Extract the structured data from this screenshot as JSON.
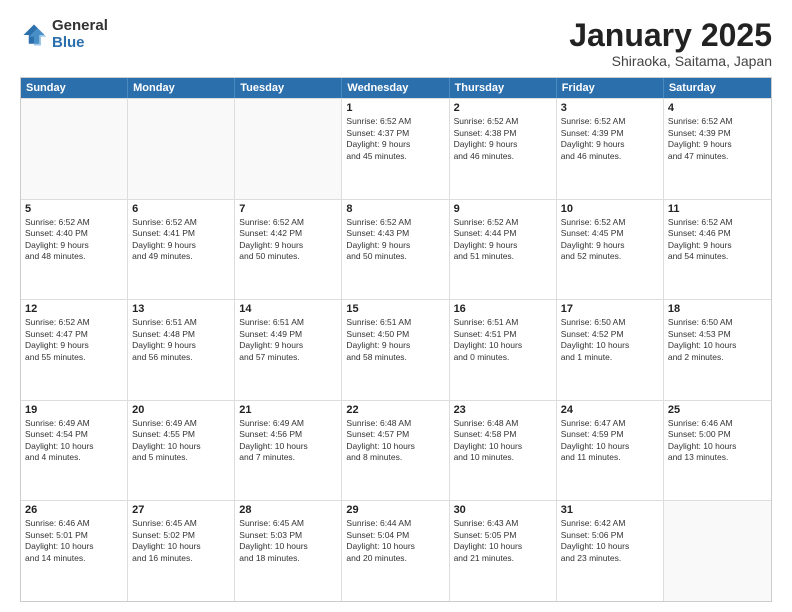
{
  "logo": {
    "general": "General",
    "blue": "Blue"
  },
  "title": {
    "month": "January 2025",
    "location": "Shiraoka, Saitama, Japan"
  },
  "header_days": [
    "Sunday",
    "Monday",
    "Tuesday",
    "Wednesday",
    "Thursday",
    "Friday",
    "Saturday"
  ],
  "weeks": [
    [
      {
        "day": "",
        "info": ""
      },
      {
        "day": "",
        "info": ""
      },
      {
        "day": "",
        "info": ""
      },
      {
        "day": "1",
        "info": "Sunrise: 6:52 AM\nSunset: 4:37 PM\nDaylight: 9 hours\nand 45 minutes."
      },
      {
        "day": "2",
        "info": "Sunrise: 6:52 AM\nSunset: 4:38 PM\nDaylight: 9 hours\nand 46 minutes."
      },
      {
        "day": "3",
        "info": "Sunrise: 6:52 AM\nSunset: 4:39 PM\nDaylight: 9 hours\nand 46 minutes."
      },
      {
        "day": "4",
        "info": "Sunrise: 6:52 AM\nSunset: 4:39 PM\nDaylight: 9 hours\nand 47 minutes."
      }
    ],
    [
      {
        "day": "5",
        "info": "Sunrise: 6:52 AM\nSunset: 4:40 PM\nDaylight: 9 hours\nand 48 minutes."
      },
      {
        "day": "6",
        "info": "Sunrise: 6:52 AM\nSunset: 4:41 PM\nDaylight: 9 hours\nand 49 minutes."
      },
      {
        "day": "7",
        "info": "Sunrise: 6:52 AM\nSunset: 4:42 PM\nDaylight: 9 hours\nand 50 minutes."
      },
      {
        "day": "8",
        "info": "Sunrise: 6:52 AM\nSunset: 4:43 PM\nDaylight: 9 hours\nand 50 minutes."
      },
      {
        "day": "9",
        "info": "Sunrise: 6:52 AM\nSunset: 4:44 PM\nDaylight: 9 hours\nand 51 minutes."
      },
      {
        "day": "10",
        "info": "Sunrise: 6:52 AM\nSunset: 4:45 PM\nDaylight: 9 hours\nand 52 minutes."
      },
      {
        "day": "11",
        "info": "Sunrise: 6:52 AM\nSunset: 4:46 PM\nDaylight: 9 hours\nand 54 minutes."
      }
    ],
    [
      {
        "day": "12",
        "info": "Sunrise: 6:52 AM\nSunset: 4:47 PM\nDaylight: 9 hours\nand 55 minutes."
      },
      {
        "day": "13",
        "info": "Sunrise: 6:51 AM\nSunset: 4:48 PM\nDaylight: 9 hours\nand 56 minutes."
      },
      {
        "day": "14",
        "info": "Sunrise: 6:51 AM\nSunset: 4:49 PM\nDaylight: 9 hours\nand 57 minutes."
      },
      {
        "day": "15",
        "info": "Sunrise: 6:51 AM\nSunset: 4:50 PM\nDaylight: 9 hours\nand 58 minutes."
      },
      {
        "day": "16",
        "info": "Sunrise: 6:51 AM\nSunset: 4:51 PM\nDaylight: 10 hours\nand 0 minutes."
      },
      {
        "day": "17",
        "info": "Sunrise: 6:50 AM\nSunset: 4:52 PM\nDaylight: 10 hours\nand 1 minute."
      },
      {
        "day": "18",
        "info": "Sunrise: 6:50 AM\nSunset: 4:53 PM\nDaylight: 10 hours\nand 2 minutes."
      }
    ],
    [
      {
        "day": "19",
        "info": "Sunrise: 6:49 AM\nSunset: 4:54 PM\nDaylight: 10 hours\nand 4 minutes."
      },
      {
        "day": "20",
        "info": "Sunrise: 6:49 AM\nSunset: 4:55 PM\nDaylight: 10 hours\nand 5 minutes."
      },
      {
        "day": "21",
        "info": "Sunrise: 6:49 AM\nSunset: 4:56 PM\nDaylight: 10 hours\nand 7 minutes."
      },
      {
        "day": "22",
        "info": "Sunrise: 6:48 AM\nSunset: 4:57 PM\nDaylight: 10 hours\nand 8 minutes."
      },
      {
        "day": "23",
        "info": "Sunrise: 6:48 AM\nSunset: 4:58 PM\nDaylight: 10 hours\nand 10 minutes."
      },
      {
        "day": "24",
        "info": "Sunrise: 6:47 AM\nSunset: 4:59 PM\nDaylight: 10 hours\nand 11 minutes."
      },
      {
        "day": "25",
        "info": "Sunrise: 6:46 AM\nSunset: 5:00 PM\nDaylight: 10 hours\nand 13 minutes."
      }
    ],
    [
      {
        "day": "26",
        "info": "Sunrise: 6:46 AM\nSunset: 5:01 PM\nDaylight: 10 hours\nand 14 minutes."
      },
      {
        "day": "27",
        "info": "Sunrise: 6:45 AM\nSunset: 5:02 PM\nDaylight: 10 hours\nand 16 minutes."
      },
      {
        "day": "28",
        "info": "Sunrise: 6:45 AM\nSunset: 5:03 PM\nDaylight: 10 hours\nand 18 minutes."
      },
      {
        "day": "29",
        "info": "Sunrise: 6:44 AM\nSunset: 5:04 PM\nDaylight: 10 hours\nand 20 minutes."
      },
      {
        "day": "30",
        "info": "Sunrise: 6:43 AM\nSunset: 5:05 PM\nDaylight: 10 hours\nand 21 minutes."
      },
      {
        "day": "31",
        "info": "Sunrise: 6:42 AM\nSunset: 5:06 PM\nDaylight: 10 hours\nand 23 minutes."
      },
      {
        "day": "",
        "info": ""
      }
    ]
  ]
}
